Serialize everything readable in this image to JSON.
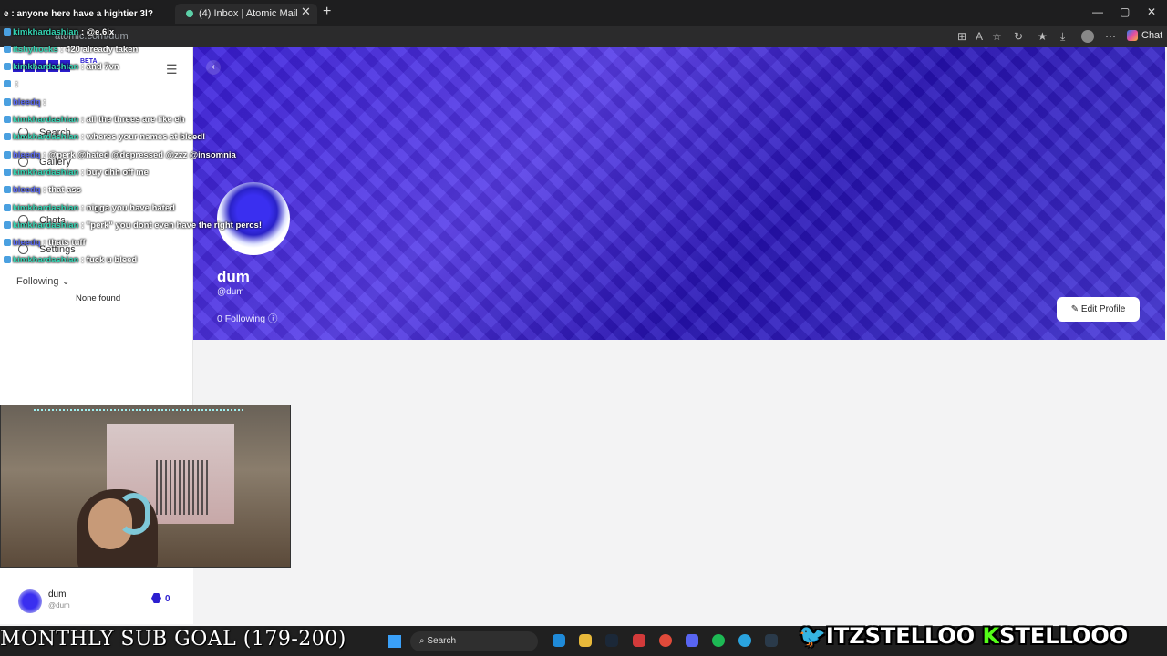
{
  "browser": {
    "tab_title": "(4) Inbox | Atomic Mail",
    "tab_close": "✕",
    "new_tab": "+",
    "url": "atomic.com/dum",
    "chat_label": "Chat",
    "window_min": "—",
    "window_max": "▢",
    "window_close": "✕"
  },
  "sidebar": {
    "beta": "BETA",
    "nav": [
      {
        "label": "Search"
      },
      {
        "label": "Gallery"
      },
      {
        "label": "Chats"
      },
      {
        "label": "Settings"
      }
    ],
    "following_label": "Following",
    "none_found": "None found"
  },
  "profile": {
    "name": "dum",
    "handle": "@dum",
    "following": "0 Following",
    "edit_button": "Edit Profile",
    "banner_color": "#3a1ed8"
  },
  "user_footer": {
    "name": "dum",
    "handle": "@dum",
    "count": "0"
  },
  "taskbar": {
    "search_label": "Search"
  },
  "stream_overlay": {
    "ticker": "e : anyone here have a hightier 3l?",
    "chat": [
      {
        "user": "kimkhardashian",
        "msg": ": @e.6ix"
      },
      {
        "user": "itshyhocks",
        "msg": ": 420 already taken"
      },
      {
        "user": "kimkhardashian",
        "msg": ": and 7vn"
      },
      {
        "user": "",
        "msg": ":"
      },
      {
        "user": "bleedq",
        "msg": ":"
      },
      {
        "user": "kimkhardashian",
        "msg": ": all the threes are like eh"
      },
      {
        "user": "kimkhardashian",
        "msg": ": wheres your names at bleed!"
      },
      {
        "user": "bleedq",
        "msg": ": @perk @hated @depressed @zzz @insomnia"
      },
      {
        "user": "kimkhardashian",
        "msg": ": buy dhh off me"
      },
      {
        "user": "bleedq",
        "msg": ": that ass"
      },
      {
        "user": "kimkhardashian",
        "msg": ": nigga you have hated"
      },
      {
        "user": "kimkhardashian",
        "msg": ": \"perk\" you dont even have the right percs!"
      },
      {
        "user": "bleedq",
        "msg": ": thats tuff"
      },
      {
        "user": "kimkhardashian",
        "msg": ": fuck u bleed"
      }
    ],
    "sub_goal": "MONTHLY SUB GOAL (179-200)",
    "twitter_handle": "ITZSTELLOO",
    "kick_handle": "STELLOOO",
    "twitter_color": "#1d9bf0",
    "kick_color": "#53fc18"
  }
}
